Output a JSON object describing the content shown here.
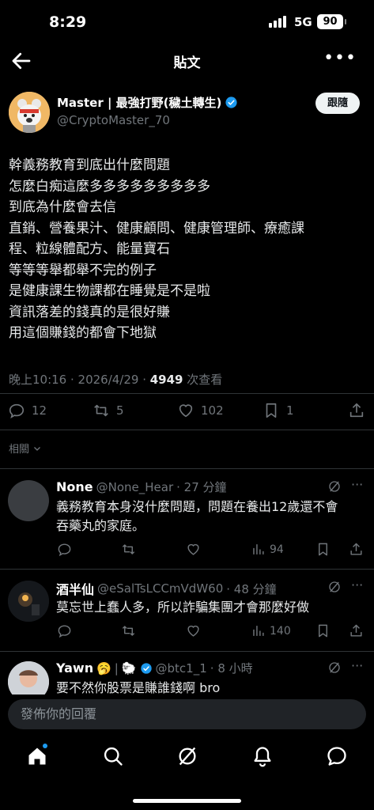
{
  "status_bar": {
    "time": "8:29",
    "network": "5G",
    "battery": "90"
  },
  "header": {
    "title": "貼文",
    "back_icon": "arrow-left-icon",
    "more_icon": "more-horizontal-icon",
    "more_label": "•••"
  },
  "author": {
    "name": "Master | 最強打野(穢土轉生)",
    "handle": "@CryptoMaster_70",
    "follow_label": "跟隨"
  },
  "tweet": {
    "lines": [
      "幹義務教育到底出什麼問題",
      "怎麼白痴這麼多多多多多多多多多",
      "到底為什麼會去信",
      "直銷、營養果汁、健康顧問、健康管理師、療癒課",
      "程、粒線體配方、能量寶石",
      "等等等舉都舉不完的例子",
      "是健康課生物課都在睡覺是不是啦",
      "資訊落差的錢真的是很好賺",
      "用這個賺錢的都會下地獄"
    ],
    "timestamp": "晚上10:16 · 2026/4/29 · ",
    "views": "4949",
    "views_label": " 次查看"
  },
  "actions": {
    "replies": "12",
    "retweets": "5",
    "likes": "102",
    "bookmarks": "1"
  },
  "sort_label": "相關",
  "replies": [
    {
      "name": "None",
      "handle": "@None_Hear",
      "time": "· 27 分鐘",
      "text_lines": [
        "義務教育本身沒什麼問題，問題在養出12歲還不會",
        "吞藥丸的家庭。"
      ],
      "views": "94"
    },
    {
      "name": "酒半仙",
      "handle": "@eSalTsLCCmVdW60",
      "time": "· 48 分鐘",
      "text_lines": [
        "莫忘世上蠢人多，所以詐騙集團才會那麼好做"
      ],
      "views": "140"
    },
    {
      "name": "Yawn",
      "emoji": "🥱",
      "separator": "|",
      "sheep": "🐑",
      "handle": "@btc1_1",
      "time": "· 8 小時",
      "text_lines": [
        "要不然你股票是賺誰錢啊 bro"
      ]
    }
  ],
  "composer": {
    "placeholder": "發佈你的回覆"
  },
  "nav": [
    "home-icon",
    "search-icon",
    "grok-icon",
    "notifications-icon",
    "messages-icon"
  ],
  "colors": {
    "accent": "#1d9bf0",
    "background": "#000000",
    "muted": "#71767b"
  }
}
